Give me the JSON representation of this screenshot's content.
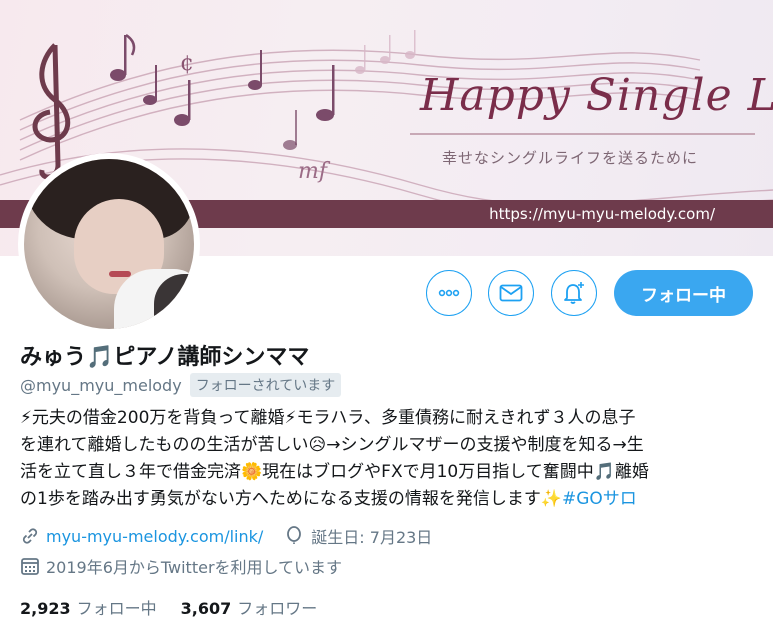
{
  "banner": {
    "title": "Happy Single Life",
    "subtitle": "幸せなシングルライフを送るために",
    "url": "https://myu-myu-melody.com/"
  },
  "actions": {
    "more_icon": "more-horizontal-icon",
    "message_icon": "envelope-icon",
    "notify_icon": "bell-plus-icon",
    "follow_label": "フォロー中"
  },
  "profile": {
    "name": "みゅう🎵ピアノ講師シンママ",
    "handle": "@myu_myu_melody",
    "follows_you": "フォローされています",
    "bio_lines": [
      "⚡元夫の借金200万を背負って離婚⚡モラハラ、多重債務に耐えきれず３人の息子",
      "を連れて離婚したものの生活が苦しい😥→シングルマザーの支援や制度を知る→生",
      "活を立て直し３年で借金完済🌼現在はブログやFXで月10万目指して奮闘中🎵離婚",
      "の1歩を踏み出す勇気がない方へためになる支援の情報を発信します✨"
    ],
    "bio_hashtag": "#GOサロ",
    "link": "myu-myu-melody.com/link/",
    "birthday": "誕生日: 7月23日",
    "joined": "2019年6月からTwitterを利用しています"
  },
  "stats": {
    "following_count": "2,923",
    "following_label": "フォロー中",
    "followers_count": "3,607",
    "followers_label": "フォロワー"
  },
  "colors": {
    "accent": "#1da1f2",
    "follow_bg": "#3aa7f0",
    "banner_bar": "#6e3b4c",
    "banner_title": "#7a2d4a"
  }
}
